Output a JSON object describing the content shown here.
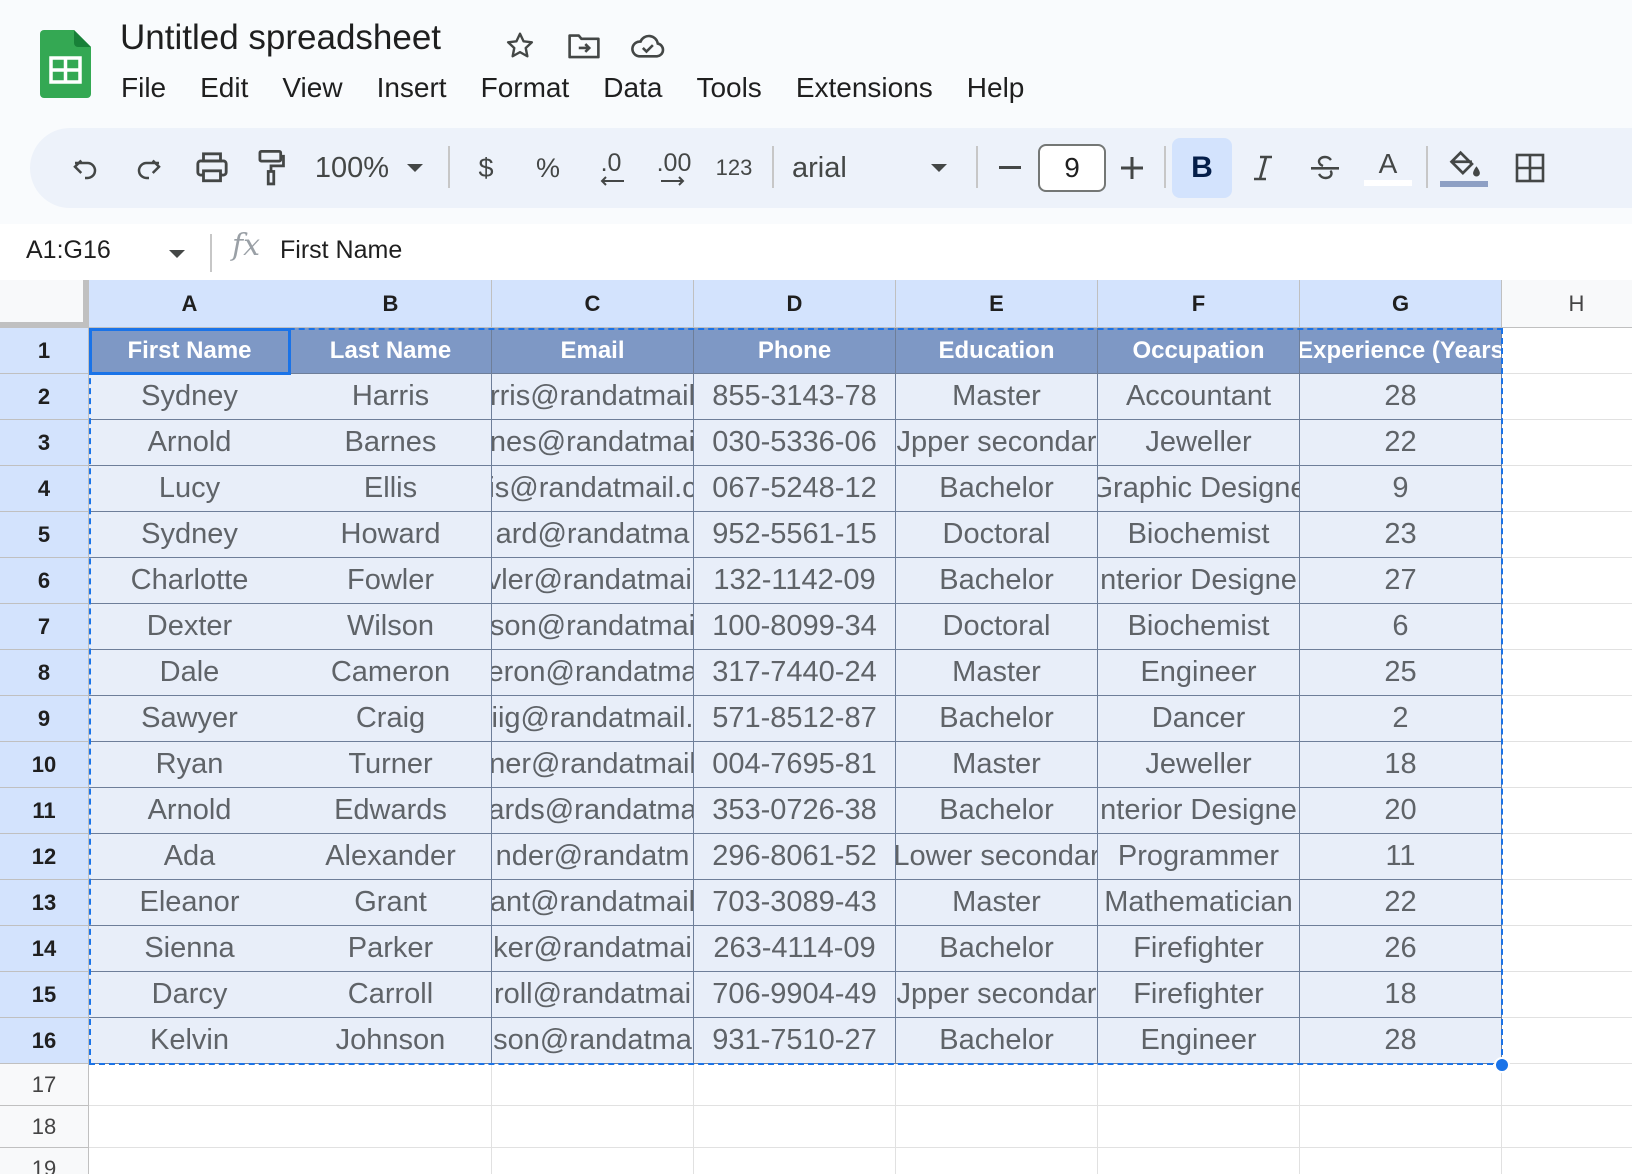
{
  "app": {
    "title": "Untitled spreadsheet",
    "menu": [
      "File",
      "Edit",
      "View",
      "Insert",
      "Format",
      "Data",
      "Tools",
      "Extensions",
      "Help"
    ]
  },
  "toolbar": {
    "zoom": "100%",
    "currency": "$",
    "percent": "%",
    "decrease_decimal": ".0",
    "increase_decimal": ".00",
    "number_format": "123",
    "font": "arial",
    "font_size": "9",
    "bold": "B",
    "text_color_label": "A"
  },
  "formula_bar": {
    "name_box": "A1:G16",
    "fx": "fx",
    "value": "First Name"
  },
  "grid": {
    "columns": [
      "A",
      "B",
      "C",
      "D",
      "E",
      "F",
      "G",
      "H"
    ],
    "row_numbers": [
      "1",
      "2",
      "3",
      "4",
      "5",
      "6",
      "7",
      "8",
      "9",
      "10",
      "11",
      "12",
      "13",
      "14",
      "15",
      "16",
      "17",
      "18",
      "19"
    ],
    "rows": [
      [
        "First Name",
        "Last Name",
        "Email",
        "Phone",
        "Education",
        "Occupation",
        "Experience (Years"
      ],
      [
        "Sydney",
        "Harris",
        "rris@randatmail",
        "855-3143-78",
        "Master",
        "Accountant",
        "28"
      ],
      [
        "Arnold",
        "Barnes",
        "nes@randatmai",
        "030-5336-06",
        "Jpper secondar",
        "Jeweller",
        "22"
      ],
      [
        "Lucy",
        "Ellis",
        "is@randatmail.c",
        "067-5248-12",
        "Bachelor",
        "Graphic Designe",
        "9"
      ],
      [
        "Sydney",
        "Howard",
        "ard@randatma",
        "952-5561-15",
        "Doctoral",
        "Biochemist",
        "23"
      ],
      [
        "Charlotte",
        "Fowler",
        "vler@randatmail",
        "132-1142-09",
        "Bachelor",
        "nterior Designe",
        "27"
      ],
      [
        "Dexter",
        "Wilson",
        "son@randatmai",
        "100-8099-34",
        "Doctoral",
        "Biochemist",
        "6"
      ],
      [
        "Dale",
        "Cameron",
        "eron@randatma",
        "317-7440-24",
        "Master",
        "Engineer",
        "25"
      ],
      [
        "Sawyer",
        "Craig",
        "iig@randatmail.",
        "571-8512-87",
        "Bachelor",
        "Dancer",
        "2"
      ],
      [
        "Ryan",
        "Turner",
        "ner@randatmail",
        "004-7695-81",
        "Master",
        "Jeweller",
        "18"
      ],
      [
        "Arnold",
        "Edwards",
        "ards@randatma",
        "353-0726-38",
        "Bachelor",
        "nterior Designe",
        "20"
      ],
      [
        "Ada",
        "Alexander",
        "nder@randatm",
        "296-8061-52",
        "Lower secondar",
        "Programmer",
        "11"
      ],
      [
        "Eleanor",
        "Grant",
        "ant@randatmail",
        "703-3089-43",
        "Master",
        "Mathematician",
        "22"
      ],
      [
        "Sienna",
        "Parker",
        "ker@randatmai",
        "263-4114-09",
        "Bachelor",
        "Firefighter",
        "26"
      ],
      [
        "Darcy",
        "Carroll",
        "roll@randatmai",
        "706-9904-49",
        "Jpper secondar",
        "Firefighter",
        "18"
      ],
      [
        "Kelvin",
        "Johnson",
        "son@randatma",
        "931-7510-27",
        "Bachelor",
        "Engineer",
        "28"
      ]
    ]
  }
}
